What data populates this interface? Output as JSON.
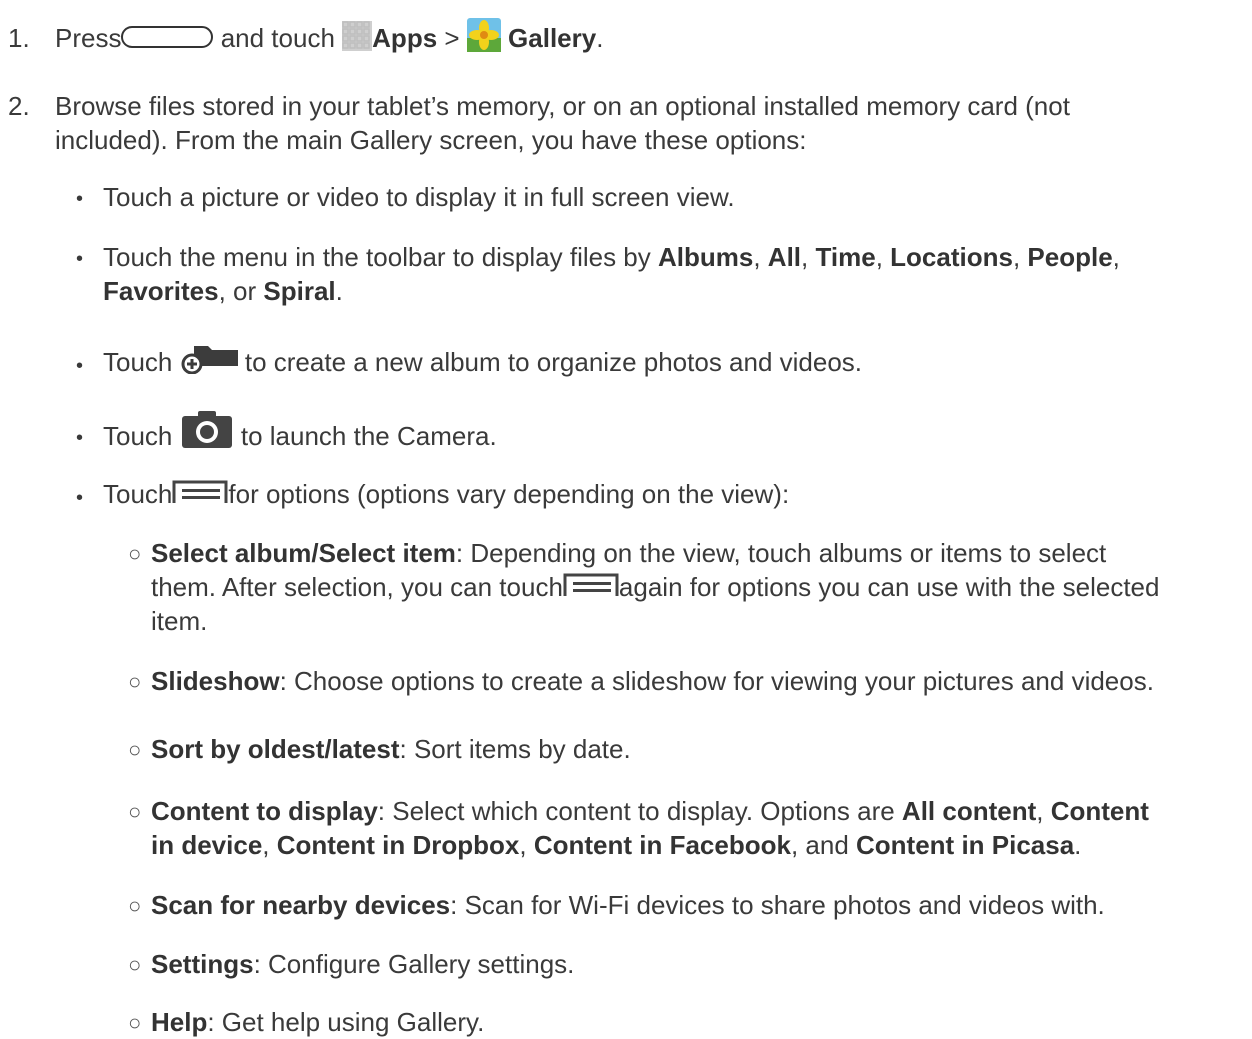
{
  "steps": [
    {
      "number": "1.",
      "parts": {
        "press": "Press",
        "and_touch": "and touch",
        "apps": "Apps",
        "gt": ">",
        "gallery": "Gallery",
        "period": "."
      }
    },
    {
      "number": "2.",
      "line1": "Browse files stored in your tablet’s memory, or on an optional installed memory card (not",
      "line2": "included). From the main Gallery screen, you have these options:"
    }
  ],
  "bullets": {
    "b1": "Touch a picture or video to display it in full screen view.",
    "b2": {
      "pre": "Touch the menu in the toolbar to display files by ",
      "albums": "Albums",
      "c1": ", ",
      "all": "All",
      "c2": ", ",
      "time": "Time",
      "c3": ", ",
      "locations": "Locations",
      "c4": ", ",
      "people": "People",
      "c5": ",",
      "favorites": "Favorites",
      "c6": ", or ",
      "spiral": "Spiral",
      "end": "."
    },
    "b3": {
      "touch": "Touch",
      "rest": "to create a new album to organize photos and videos."
    },
    "b4": {
      "touch": "Touch",
      "rest": "to launch the Camera."
    },
    "b5": {
      "touch": "Touch",
      "rest": "for options (options vary depending on the view):"
    }
  },
  "subitems": {
    "s1": {
      "term": "Select album/Select item",
      "line1_rest": ": Depending on the view, touch albums or items to select",
      "line2_pre": "them. After selection, you can touch",
      "line2_post": "again for options you can use with the selected",
      "line3": "item."
    },
    "s2": {
      "term": "Slideshow",
      "rest": ": Choose options to create a slideshow for viewing your pictures and videos."
    },
    "s3": {
      "term": "Sort by oldest/latest",
      "rest": ": Sort items by date."
    },
    "s4": {
      "term": "Content to display",
      "line1_rest": ": Select which content to display. Options are ",
      "all_content": "All content",
      "comma1": ", ",
      "content_pre": "Content",
      "in_device": "in device",
      "comma2": ", ",
      "dropbox": "Content in Dropbox",
      "comma3": ", ",
      "facebook": "Content in Facebook",
      "and": ", and ",
      "picasa": "Content in Picasa",
      "end": "."
    },
    "s5": {
      "term": "Scan for nearby devices",
      "rest": ": Scan for Wi-Fi devices to share photos and videos with."
    },
    "s6": {
      "term": "Settings",
      "rest": ": Configure Gallery settings."
    },
    "s7": {
      "term": "Help",
      "rest": ": Get help using Gallery."
    }
  },
  "marks": {
    "bullet": "•",
    "sub_bullet": "○"
  },
  "icons": {
    "home_button": "home-button-icon",
    "apps": "apps-grid-icon",
    "gallery": "gallery-flower-icon",
    "new_album": "new-album-folder-icon",
    "camera": "camera-icon",
    "menu": "menu-icon"
  },
  "colors": {
    "text": "#3a3a3a",
    "icon_dark": "#444444",
    "icon_light": "#cfcfcf"
  }
}
